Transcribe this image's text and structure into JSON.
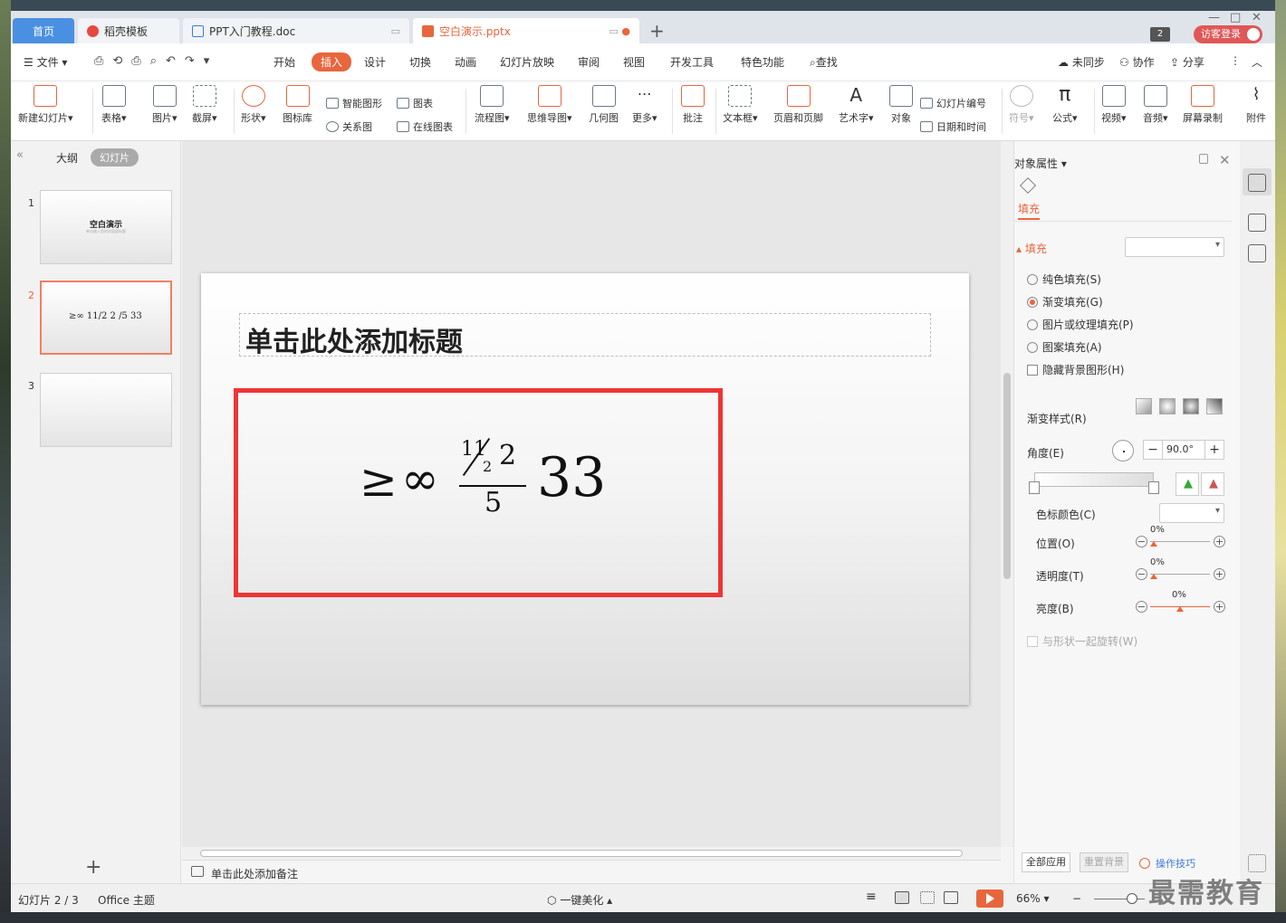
{
  "tabs": [
    {
      "label": "首页",
      "kind": "home"
    },
    {
      "label": "稻壳模板",
      "kind": "docer"
    },
    {
      "label": "PPT入门教程.doc",
      "kind": "writer"
    },
    {
      "label": "空白演示.pptx",
      "kind": "presentation",
      "active": true
    }
  ],
  "titlebar": {
    "badge_count": "2",
    "guest_label": "访客登录"
  },
  "menu": {
    "file": "文件",
    "items": [
      "开始",
      "插入",
      "设计",
      "切换",
      "动画",
      "幻灯片放映",
      "审阅",
      "视图",
      "开发工具",
      "特色功能"
    ],
    "active": "插入",
    "search": "查找",
    "sync": "未同步",
    "collab": "协作",
    "share": "分享"
  },
  "ribbon": {
    "new_slide": "新建幻灯片",
    "table": "表格",
    "picture": "图片",
    "screenshot": "截屏",
    "shape": "形状",
    "icon_lib": "图标库",
    "smart_shape": "智能图形",
    "relation": "关系图",
    "chart": "图表",
    "online_chart": "在线图表",
    "flowchart": "流程图",
    "mindmap": "思维导图",
    "geometry": "几何图",
    "more": "更多",
    "comment": "批注",
    "textbox": "文本框",
    "header_footer": "页眉和页脚",
    "wordart": "艺术字",
    "object": "对象",
    "slide_number": "幻灯片编号",
    "datetime": "日期和时间",
    "symbol": "符号",
    "formula": "公式",
    "video": "视频",
    "audio": "音频",
    "screen_record": "屏幕录制",
    "attachment": "附件"
  },
  "left_pane": {
    "outline": "大纲",
    "slides": "幻灯片",
    "thumbs": [
      {
        "num": "1",
        "title": "空白演示",
        "subtitle": "单击输入您的封面副标题"
      },
      {
        "num": "2",
        "formula": "≥∞ 11/2 2 /5 33"
      },
      {
        "num": "3"
      }
    ]
  },
  "slide": {
    "title_placeholder": "单击此处添加标题",
    "formula": {
      "ge": "≥",
      "inf": "∞",
      "num_a": "11",
      "num_b": "2",
      "num_c": "2",
      "den": "5",
      "tail": "33"
    }
  },
  "notes_placeholder": "单击此处添加备注",
  "panel": {
    "title": "对象属性",
    "fill_tab": "填充",
    "fill_section": "填充",
    "options": [
      {
        "label": "纯色填充(S)",
        "selected": false
      },
      {
        "label": "渐变填充(G)",
        "selected": true
      },
      {
        "label": "图片或纹理填充(P)",
        "selected": false
      },
      {
        "label": "图案填充(A)",
        "selected": false
      }
    ],
    "hide_bg": "隐藏背景图形(H)",
    "gradient_style": "渐变样式(R)",
    "angle_label": "角度(E)",
    "angle_value": "90.0°",
    "stop_color": "色标颜色(C)",
    "position": "位置(O)",
    "position_value": "0%",
    "transparency": "透明度(T)",
    "transparency_value": "0%",
    "brightness": "亮度(B)",
    "brightness_value": "0%",
    "rotate_with_shape": "与形状一起旋转(W)",
    "apply_all": "全部应用",
    "reset_bg": "重置背景",
    "tips": "操作技巧"
  },
  "status": {
    "slide_info": "幻灯片 2 / 3",
    "theme": "Office 主题",
    "beautify": "一键美化",
    "zoom": "66%"
  },
  "watermark": "最需教育"
}
